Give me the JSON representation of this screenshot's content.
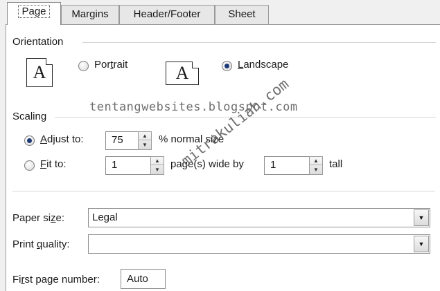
{
  "tabs": [
    {
      "label": "Page",
      "active": true
    },
    {
      "label": "Margins",
      "active": false
    },
    {
      "label": "Header/Footer",
      "active": false
    },
    {
      "label": "Sheet",
      "active": false
    }
  ],
  "orientation": {
    "group_label": "Orientation",
    "portrait_icon_glyph": "A",
    "portrait_prefix": "Por",
    "portrait_ul": "t",
    "portrait_suffix": "rait",
    "portrait_selected": false,
    "landscape_icon_glyph": "A",
    "landscape_ul": "L",
    "landscape_suffix": "andscape",
    "landscape_selected": true
  },
  "scaling": {
    "group_label": "Scaling",
    "adjust_ul": "A",
    "adjust_suffix": "djust to:",
    "adjust_selected": true,
    "adjust_value": "75",
    "adjust_unit": "% normal size",
    "fit_ul": "F",
    "fit_suffix": "it to:",
    "fit_selected": false,
    "fit_wide_value": "1",
    "fit_wide_label": "page(s) wide by",
    "fit_tall_value": "1",
    "fit_tall_label": "tall"
  },
  "paper_size": {
    "prefix": "Paper si",
    "ul": "z",
    "suffix": "e:",
    "value": "Legal"
  },
  "print_quality": {
    "prefix": "Print ",
    "ul": "q",
    "suffix": "uality:",
    "value": ""
  },
  "first_page": {
    "prefix": "Fi",
    "ul": "r",
    "suffix": "st page number:",
    "value": "Auto"
  },
  "watermark": {
    "line1": "tentangwebsites.blogspot.com",
    "line2": "mitrakuliah.com"
  },
  "colors": {
    "panel": "#ffffff",
    "dialog": "#f0f0f0",
    "radio_dot": "#1d3a75"
  }
}
